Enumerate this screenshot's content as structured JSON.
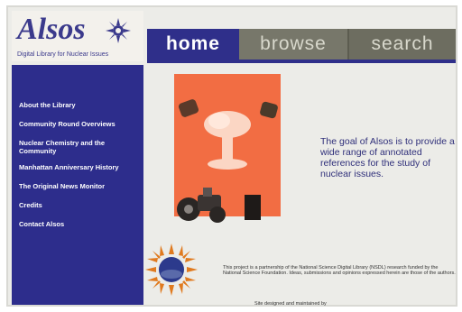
{
  "logo": {
    "wordmark": "Alsos",
    "tagline": "Digital Library for Nuclear Issues",
    "burst_icon": "sun-burst-icon"
  },
  "tabs": [
    {
      "label": "home"
    },
    {
      "label": "browse"
    },
    {
      "label": "search"
    }
  ],
  "sidebar": {
    "items": [
      {
        "label": "About the Library"
      },
      {
        "label": "Community Round Overviews"
      },
      {
        "label": "Nuclear Chemistry and the Community"
      },
      {
        "label": "Manhattan Anniversary History"
      },
      {
        "label": "The Original News Monitor"
      },
      {
        "label": "Credits"
      },
      {
        "label": "Contact Alsos"
      }
    ]
  },
  "main": {
    "intro": "The goal of Alsos is to provide a wide range of annotated references for the study of nuclear issues.",
    "nsf_text": "This project is a partnership of the National Science Digital Library (NSDL) research funded by the National Science Foundation. Ideas, submissions and opinions expressed herein are those of the authors.",
    "design_text": "Site designed and maintained by"
  },
  "colors": {
    "nav_blue": "#2d2d8c",
    "poster_orange": "#f26d43",
    "tab_gray": "#77776a"
  }
}
